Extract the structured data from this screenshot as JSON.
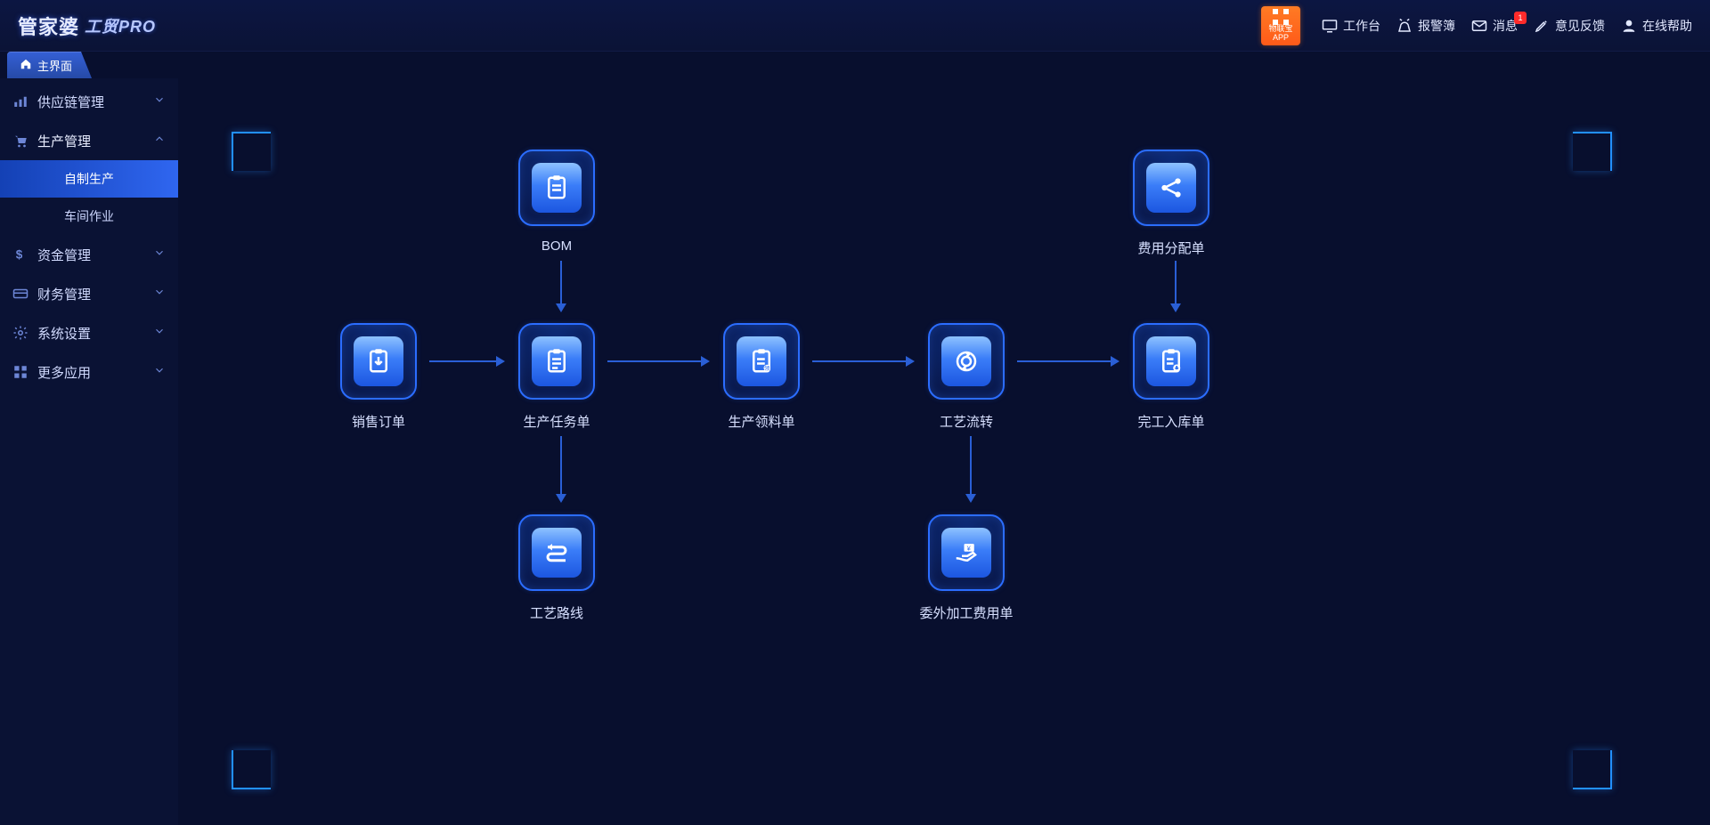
{
  "brand": {
    "cn": "管家婆",
    "product": "工贸PRO"
  },
  "header": {
    "app_badge_line1": "物联宝",
    "app_badge_line2": "APP",
    "items": [
      {
        "id": "workbench",
        "label": "工作台"
      },
      {
        "id": "alarmbook",
        "label": "报警簿"
      },
      {
        "id": "messages",
        "label": "消息",
        "badge": "1"
      },
      {
        "id": "feedback",
        "label": "意见反馈"
      },
      {
        "id": "help",
        "label": "在线帮助"
      }
    ]
  },
  "tab": {
    "label": "主界面"
  },
  "sidebar": {
    "groups": [
      {
        "id": "supply",
        "label": "供应链管理",
        "expanded": false
      },
      {
        "id": "prod",
        "label": "生产管理",
        "expanded": true,
        "children": [
          {
            "id": "selfmade",
            "label": "自制生产",
            "active": true
          },
          {
            "id": "workshop",
            "label": "车间作业",
            "active": false
          }
        ]
      },
      {
        "id": "fund",
        "label": "资金管理",
        "expanded": false
      },
      {
        "id": "finance",
        "label": "财务管理",
        "expanded": false
      },
      {
        "id": "system",
        "label": "系统设置",
        "expanded": false
      },
      {
        "id": "moreapp",
        "label": "更多应用",
        "expanded": false
      }
    ]
  },
  "diagram": {
    "nodes": {
      "bom": {
        "label": "BOM"
      },
      "sales_order": {
        "label": "销售订单"
      },
      "prod_task": {
        "label": "生产任务单"
      },
      "material_req": {
        "label": "生产领料单"
      },
      "routing_flow": {
        "label": "工艺流转"
      },
      "cost_alloc": {
        "label": "费用分配单"
      },
      "finish_in": {
        "label": "完工入库单"
      },
      "process_route": {
        "label": "工艺路线"
      },
      "outsource_fee": {
        "label": "委外加工费用单"
      }
    }
  }
}
